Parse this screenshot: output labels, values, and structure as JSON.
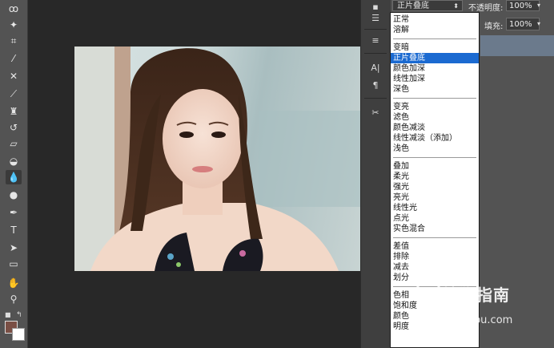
{
  "blend_mode": {
    "current": "正片叠底",
    "selected": "正片叠底",
    "groups": [
      [
        "正常",
        "溶解"
      ],
      [
        "变暗",
        "正片叠底",
        "颜色加深",
        "线性加深",
        "深色"
      ],
      [
        "变亮",
        "滤色",
        "颜色减淡",
        "线性减淡（添加）",
        "浅色"
      ],
      [
        "叠加",
        "柔光",
        "强光",
        "亮光",
        "线性光",
        "点光",
        "实色混合"
      ],
      [
        "差值",
        "排除",
        "减去",
        "划分"
      ],
      [
        "色相",
        "饱和度",
        "颜色",
        "明度"
      ]
    ]
  },
  "layers": {
    "opacity_label": "不透明度:",
    "opacity_value": "100%",
    "fill_label": "填充:",
    "fill_value": "100%"
  },
  "colors": {
    "foreground": "#7a4f45",
    "background": "#ffffff",
    "menu_highlight": "#1b6ad1"
  },
  "watermark": {
    "text": "搜狗指南",
    "url": "zhinan.sogou.com"
  }
}
